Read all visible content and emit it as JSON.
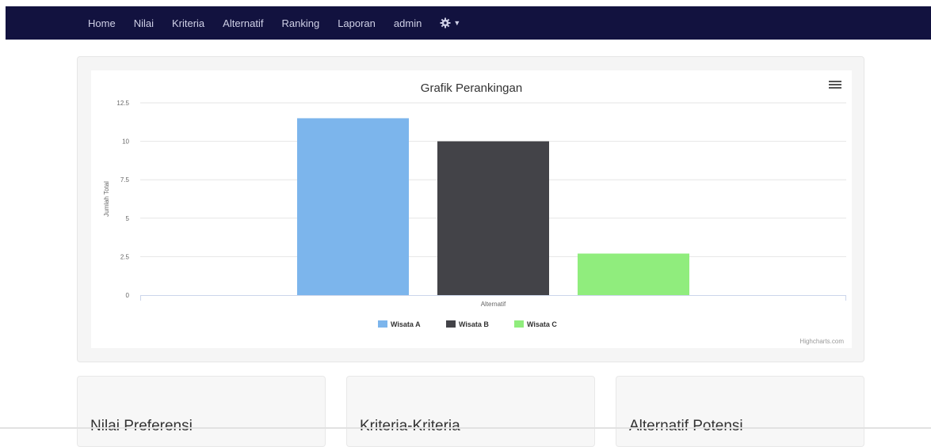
{
  "navbar": {
    "links": [
      "Home",
      "Nilai",
      "Kriteria",
      "Alternatif",
      "Ranking",
      "Laporan",
      "admin"
    ],
    "settings_icon": "gear-icon",
    "background": "#12123f"
  },
  "chart_data": {
    "type": "bar",
    "title": "Grafik Perankingan",
    "xlabel": "Alternatif",
    "ylabel": "Jumlah Total",
    "categories": [
      "Alternatif"
    ],
    "ylim": [
      0,
      12.5
    ],
    "yticks": [
      "0",
      "2.5",
      "5",
      "7.5",
      "10",
      "12.5"
    ],
    "series": [
      {
        "name": "Wisata A",
        "values": [
          11.5
        ],
        "color": "#7cb5ec"
      },
      {
        "name": "Wisata B",
        "values": [
          10
        ],
        "color": "#434348"
      },
      {
        "name": "Wisata C",
        "values": [
          2.7
        ],
        "color": "#90ed7d"
      }
    ],
    "legend_position": "bottom-center",
    "grid": true,
    "credits": "Highcharts.com"
  },
  "panels": [
    {
      "title": "Nilai Preferensi"
    },
    {
      "title": "Kriteria-Kriteria"
    },
    {
      "title": "Alternatif Potensi"
    }
  ]
}
